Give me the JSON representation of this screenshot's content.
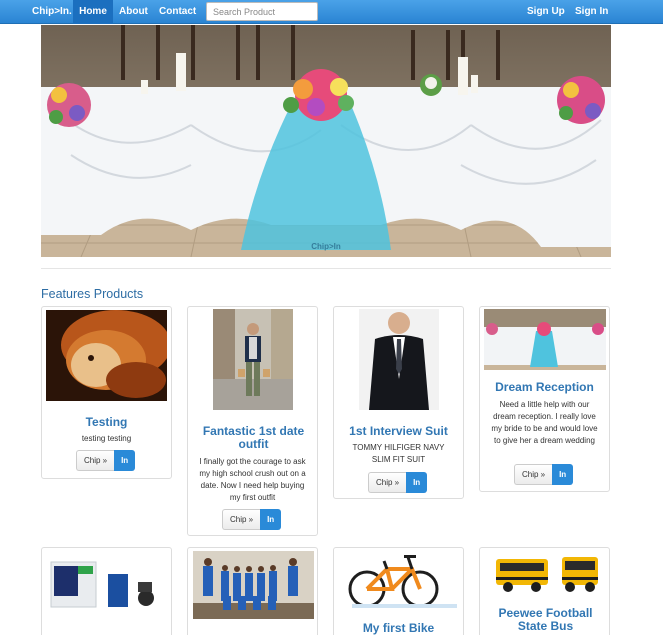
{
  "nav": {
    "brand": "Chip>In.",
    "home": "Home",
    "about": "About",
    "contact": "Contact",
    "search_placeholder": "Search Product",
    "signup": "Sign Up",
    "signin": "Sign In"
  },
  "hero": {
    "caption": "Chip>In"
  },
  "section_title": "Features Products",
  "buttons": {
    "chip": "Chip »",
    "in": "In"
  },
  "products": [
    {
      "title": "Testing",
      "description": "testing testing"
    },
    {
      "title": "Fantastic 1st date outfit",
      "description": "I finally got the courage to ask my high school crush out on a date. Now I need help buying my first outfit"
    },
    {
      "title": "1st Interview Suit",
      "description": "TOMMY HILFIGER NAVY SLIM FIT SUIT"
    },
    {
      "title": "Dream Reception",
      "description": "Need a little help with our dream reception. I really love my bride to be and would love to give her a dream wedding"
    },
    {
      "title": "",
      "description": ""
    },
    {
      "title": "",
      "description": ""
    },
    {
      "title": "My first Bike",
      "description": ""
    },
    {
      "title": "Peewee Football State Bus",
      "description": ""
    }
  ],
  "colors": {
    "navbar": "#2a84d3",
    "accent": "#3277b3",
    "in_button": "#2a8ad8"
  }
}
